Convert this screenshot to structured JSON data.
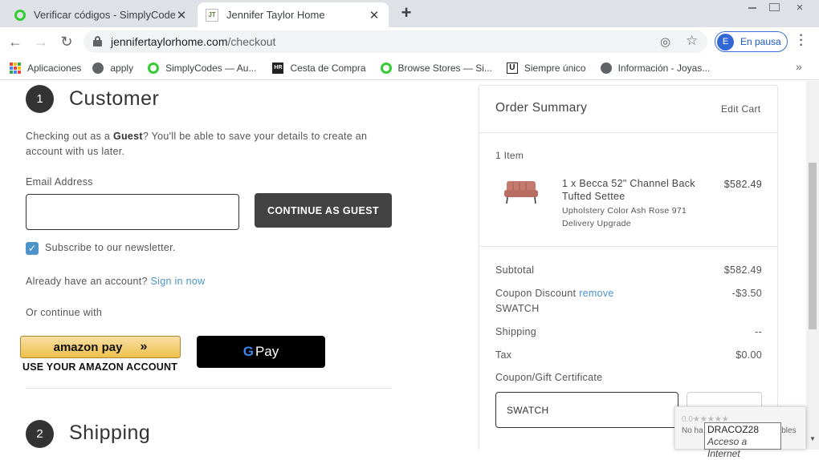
{
  "browser": {
    "tabs": [
      {
        "title": "Verificar códigos - SimplyCodes",
        "close": "✕"
      },
      {
        "title": "Jennifer Taylor Home",
        "close": "✕"
      }
    ],
    "new_tab": "+",
    "url_host": "jenniferta­ylorhome.com",
    "url_host_clean": "jennifertaylorhome.com",
    "url_path": "/checkout",
    "profile_initial": "E",
    "profile_label": "En pausa",
    "bookmarks": [
      {
        "label": "Aplicaciones",
        "icon": "apps-icon"
      },
      {
        "label": "apply",
        "icon": "globe-icon"
      },
      {
        "label": "SimplyCodes — Au...",
        "icon": "simplycodes-icon"
      },
      {
        "label": "Cesta de Compra",
        "icon": "hr-icon"
      },
      {
        "label": "Browse Stores — Si...",
        "icon": "simplycodes-icon"
      },
      {
        "label": "Siempre único",
        "icon": "u-icon"
      },
      {
        "label": "Información - Joyas...",
        "icon": "globe-icon"
      }
    ],
    "bookmarks_more": "»"
  },
  "checkout": {
    "customer": {
      "step": "1",
      "title": "Customer",
      "intro_pre": "Checking out as a ",
      "intro_bold": "Guest",
      "intro_post": "? You'll be able to save your details to create an account with us later.",
      "email_label": "Email Address",
      "email_value": "",
      "continue_button": "CONTINUE AS GUEST",
      "newsletter_label": "Subscribe to our newsletter.",
      "newsletter_checked": true,
      "have_account": "Already have an account?",
      "sign_in": "Sign in now",
      "or_continue": "Or continue with",
      "amazon_label": "amazon pay",
      "amazon_arrows": "»",
      "amazon_sub": "USE YOUR AMAZON ACCOUNT",
      "gpay_g": "G",
      "gpay_label": "Pay"
    },
    "shipping": {
      "step": "2",
      "title": "Shipping"
    }
  },
  "summary": {
    "title": "Order Summary",
    "edit_cart": "Edit Cart",
    "item_count": "1 Item",
    "item": {
      "name": "1 x Becca 52\" Channel Back Tufted Settee",
      "price": "$582.49",
      "option1": "Upholstery Color Ash Rose 971",
      "option2": "Delivery Upgrade"
    },
    "subtotal_label": "Subtotal",
    "subtotal_value": "$582.49",
    "coupon_label": "Coupon Discount",
    "coupon_remove": "remove",
    "coupon_code": "SWATCH",
    "coupon_value": "-$3.50",
    "shipping_label": "Shipping",
    "shipping_value": "--",
    "tax_label": "Tax",
    "tax_value": "$0.00",
    "gift_label": "Coupon/Gift Certificate",
    "gift_input_value": "SWATCH"
  },
  "overlay": {
    "rating_stars": "0.0★★★★★",
    "rating_no": "No ha",
    "rating_tail": "ibles",
    "tooltip_title": "DRACOZ28",
    "tooltip_sub": "Acceso a Internet"
  },
  "colors": {
    "accent": "#4b93c9",
    "dark_button": "#424242",
    "amazon_gold": "#f0c14b"
  }
}
